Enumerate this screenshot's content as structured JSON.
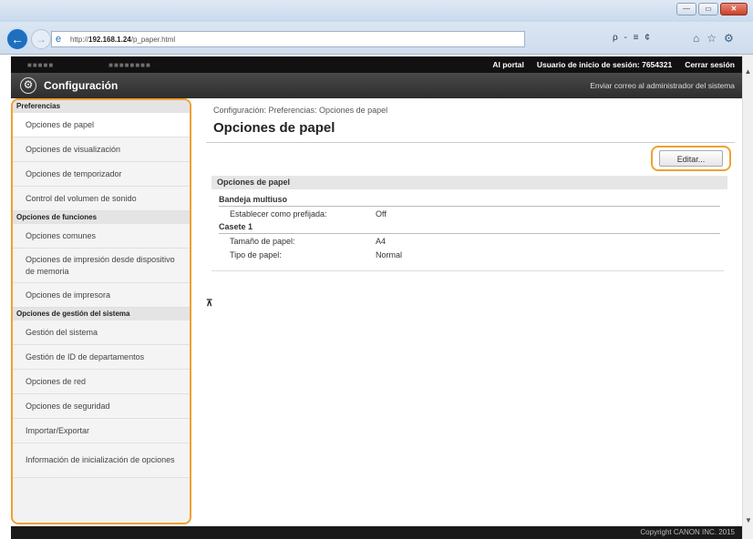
{
  "browser": {
    "url_prefix": "http://",
    "url_host": "192.168.1.24",
    "url_path": "/p_paper.html",
    "url_tools": "ρ - ≡ ¢",
    "win_min": "—",
    "win_max": "▭",
    "win_close": "✕",
    "home_icon": "⌂",
    "star_icon": "☆",
    "settings_icon": "⚙"
  },
  "header": {
    "portal": "Al portal",
    "user_label": "Usuario de inicio de sesión:",
    "user_id": "7654321",
    "logout": "Cerrar sesión",
    "title": "Configuración",
    "mail_admin": "Enviar correo al administrador del sistema"
  },
  "sidebar": {
    "sections": [
      {
        "title": "Preferencias",
        "items": [
          "Opciones de papel",
          "Opciones de visualización",
          "Opciones de temporizador",
          "Control del volumen de sonido"
        ]
      },
      {
        "title": "Opciones de funciones",
        "items": [
          "Opciones comunes",
          "Opciones de impresión desde dispositivo de memoria",
          "Opciones de impresora"
        ]
      },
      {
        "title": "Opciones de gestión del sistema",
        "items": [
          "Gestión del sistema",
          "Gestión de ID de departamentos",
          "Opciones de red",
          "Opciones de seguridad",
          "Importar/Exportar",
          "Información de inicialización de opciones"
        ]
      }
    ]
  },
  "main": {
    "breadcrumb": "Configuración: Preferencias: Opciones de papel",
    "title": "Opciones de papel",
    "edit_button": "Editar...",
    "panel_title": "Opciones de papel",
    "groups": [
      {
        "title": "Bandeja multiuso",
        "rows": [
          {
            "label": "Establecer como prefijada:",
            "value": "Off"
          }
        ]
      },
      {
        "title": "Casete 1",
        "rows": [
          {
            "label": "Tamaño de papel:",
            "value": "A4"
          },
          {
            "label": "Tipo de papel:",
            "value": "Normal"
          }
        ]
      }
    ],
    "top_icon": "⊼"
  },
  "footer": {
    "copyright": "Copyright CANON INC. 2015"
  }
}
